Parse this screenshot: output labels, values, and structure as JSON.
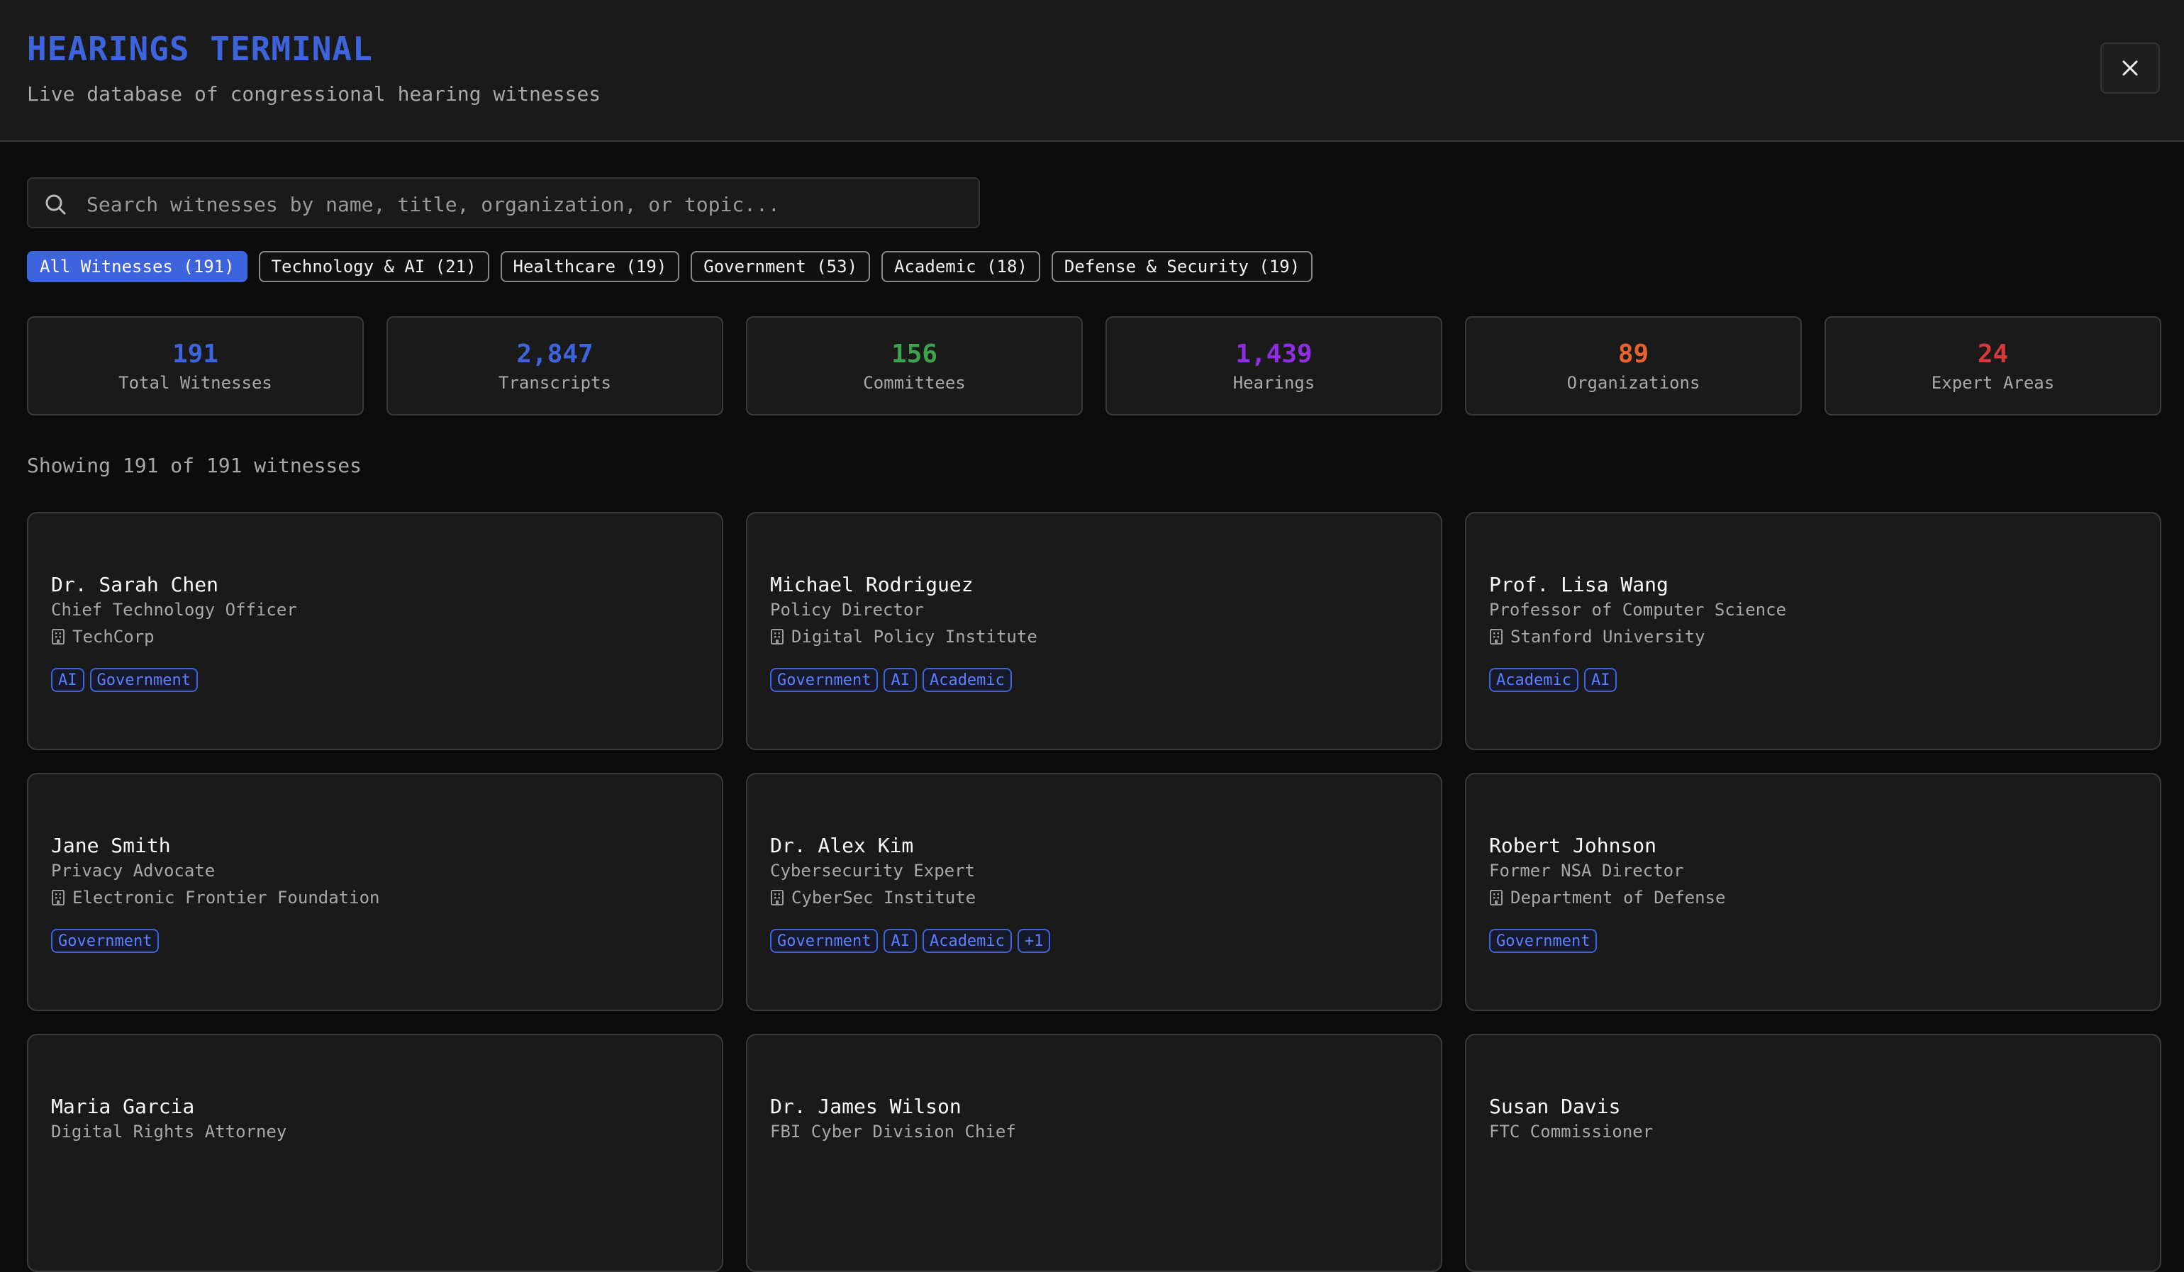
{
  "header": {
    "title": "HEARINGS TERMINAL",
    "subtitle": "Live database of congressional hearing witnesses",
    "close_icon": "close-icon"
  },
  "search": {
    "placeholder": "Search witnesses by name, title, organization, or topic..."
  },
  "filters": [
    {
      "label": "All Witnesses (191)",
      "active": true
    },
    {
      "label": "Technology & AI (21)",
      "active": false
    },
    {
      "label": "Healthcare (19)",
      "active": false
    },
    {
      "label": "Government (53)",
      "active": false
    },
    {
      "label": "Academic (18)",
      "active": false
    },
    {
      "label": "Defense & Security (19)",
      "active": false
    }
  ],
  "stats": [
    {
      "value": "191",
      "label": "Total Witnesses",
      "color": "#3d63dd"
    },
    {
      "value": "2,847",
      "label": "Transcripts",
      "color": "#3d63dd"
    },
    {
      "value": "156",
      "label": "Committees",
      "color": "#3fa34d"
    },
    {
      "value": "1,439",
      "label": "Hearings",
      "color": "#8e2de2"
    },
    {
      "value": "89",
      "label": "Organizations",
      "color": "#e8622c"
    },
    {
      "value": "24",
      "label": "Expert Areas",
      "color": "#d83a3a"
    }
  ],
  "showing": "Showing 191 of 191 witnesses",
  "witnesses": [
    {
      "name": "Dr. Sarah Chen",
      "title": "Chief Technology Officer",
      "org": "TechCorp",
      "tags": [
        "AI",
        "Government"
      ]
    },
    {
      "name": "Michael Rodriguez",
      "title": "Policy Director",
      "org": "Digital Policy Institute",
      "tags": [
        "Government",
        "AI",
        "Academic"
      ]
    },
    {
      "name": "Prof. Lisa Wang",
      "title": "Professor of Computer Science",
      "org": "Stanford University",
      "tags": [
        "Academic",
        "AI"
      ]
    },
    {
      "name": "Jane Smith",
      "title": "Privacy Advocate",
      "org": "Electronic Frontier Foundation",
      "tags": [
        "Government"
      ]
    },
    {
      "name": "Dr. Alex Kim",
      "title": "Cybersecurity Expert",
      "org": "CyberSec Institute",
      "tags": [
        "Government",
        "AI",
        "Academic",
        "+1"
      ]
    },
    {
      "name": "Robert Johnson",
      "title": "Former NSA Director",
      "org": "Department of Defense",
      "tags": [
        "Government"
      ]
    },
    {
      "name": "Maria Garcia",
      "title": "Digital Rights Attorney",
      "org": "",
      "tags": []
    },
    {
      "name": "Dr. James Wilson",
      "title": "FBI Cyber Division Chief",
      "org": "",
      "tags": []
    },
    {
      "name": "Susan Davis",
      "title": "FTC Commissioner",
      "org": "",
      "tags": []
    }
  ]
}
